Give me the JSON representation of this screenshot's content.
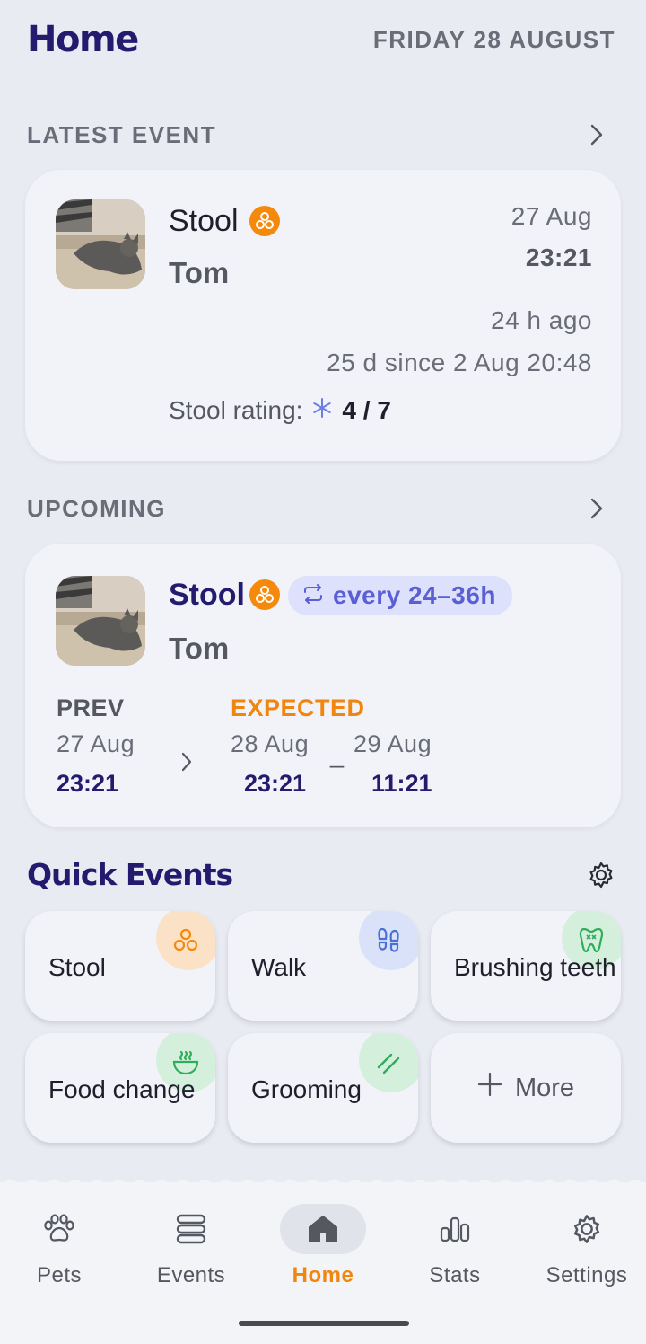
{
  "header": {
    "title": "Home",
    "date": "FRIDAY 28 AUGUST"
  },
  "latest": {
    "section_title": "LATEST EVENT",
    "event": "Stool",
    "pet": "Tom",
    "date": "27 Aug",
    "time": "23:21",
    "ago": "24 h ago",
    "since": "25 d since 2 Aug 20:48",
    "rating_label": "Stool rating:",
    "rating_value": "4 / 7"
  },
  "upcoming": {
    "section_title": "UPCOMING",
    "event": "Stool",
    "pet": "Tom",
    "frequency": "every 24–36h",
    "prev_label": "PREV",
    "prev_date": "27 Aug",
    "prev_time": "23:21",
    "expected_label": "EXPECTED",
    "exp_from_date": "28 Aug",
    "exp_from_time": "23:21",
    "separator": "_",
    "exp_to_date": "29 Aug",
    "exp_to_time": "11:21"
  },
  "quick_events": {
    "title": "Quick Events",
    "tiles": [
      {
        "label": "Stool",
        "icon": "stool-icon",
        "color": "#f5890c"
      },
      {
        "label": "Walk",
        "icon": "footprints-icon",
        "color": "#4a70d8"
      },
      {
        "label": "Brushing teeth",
        "icon": "tooth-icon",
        "color": "#2fae5a"
      },
      {
        "label": "Food change",
        "icon": "food-bowl-icon",
        "color": "#2fae5a"
      },
      {
        "label": "Grooming",
        "icon": "grooming-icon",
        "color": "#2fae5a"
      },
      {
        "label": "More",
        "icon": "plus-icon"
      }
    ]
  },
  "nav": {
    "items": [
      {
        "label": "Pets",
        "icon": "paw-icon"
      },
      {
        "label": "Events",
        "icon": "list-icon"
      },
      {
        "label": "Home",
        "icon": "home-icon",
        "active": true
      },
      {
        "label": "Stats",
        "icon": "bar-chart-icon"
      },
      {
        "label": "Settings",
        "icon": "gear-icon"
      }
    ]
  },
  "colors": {
    "accent": "#f0860f",
    "brand": "#241a6e",
    "background": "#e8ebf2",
    "card": "#f1f3f8"
  }
}
